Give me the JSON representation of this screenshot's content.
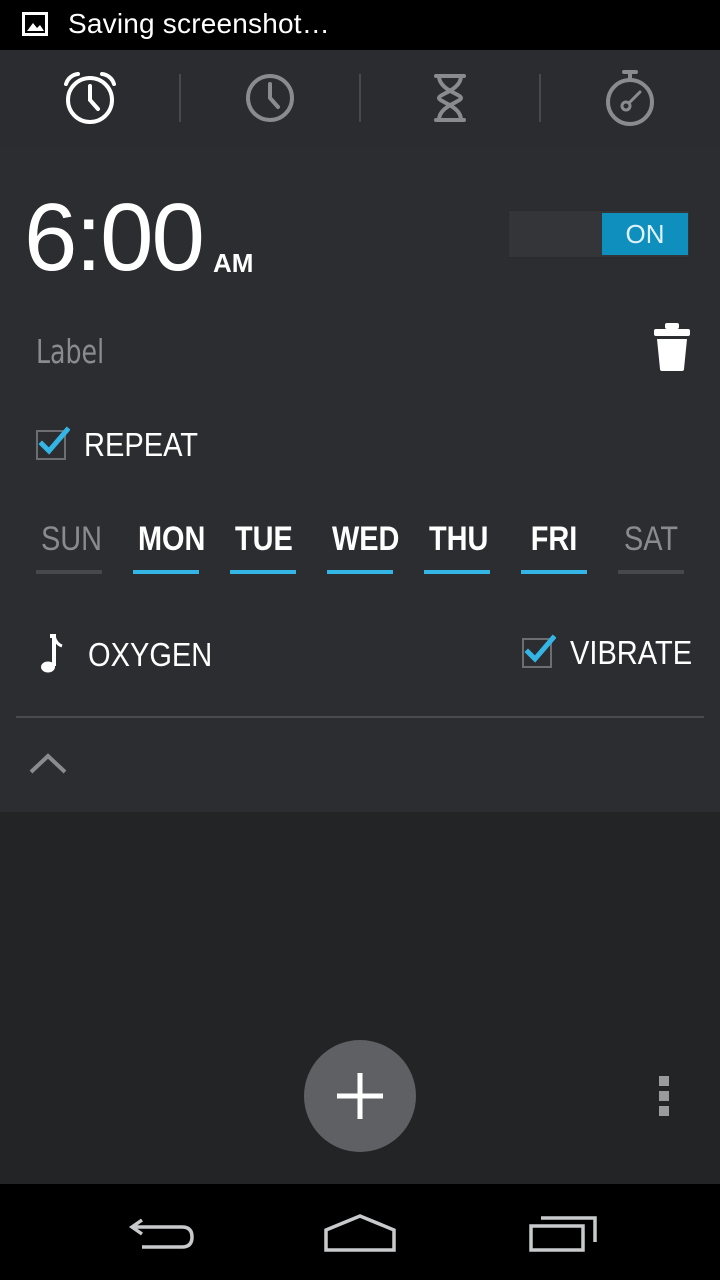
{
  "status_bar": {
    "notification_icon": "image-icon",
    "text": "Saving screenshot…"
  },
  "tabs": [
    {
      "name": "alarm",
      "icon": "alarm-clock-icon",
      "selected": true
    },
    {
      "name": "clock",
      "icon": "clock-icon",
      "selected": false
    },
    {
      "name": "timer",
      "icon": "hourglass-icon",
      "selected": false
    },
    {
      "name": "stopwatch",
      "icon": "stopwatch-icon",
      "selected": false
    }
  ],
  "alarm": {
    "time": "6:00",
    "ampm": "AM",
    "toggle_label": "ON",
    "label_placeholder": "Label",
    "repeat_label": "REPEAT",
    "repeat_checked": true,
    "days": [
      {
        "label": "SUN",
        "active": false
      },
      {
        "label": "MON",
        "active": true
      },
      {
        "label": "TUE",
        "active": true
      },
      {
        "label": "WED",
        "active": true
      },
      {
        "label": "THU",
        "active": true
      },
      {
        "label": "FRI",
        "active": true
      },
      {
        "label": "SAT",
        "active": false
      }
    ],
    "ringtone_icon": "music-note-icon",
    "ringtone": "OXYGEN",
    "vibrate_label": "VIBRATE",
    "vibrate_checked": true,
    "collapse_icon": "chevron-up-icon",
    "delete_icon": "trash-icon"
  },
  "fab_icon": "plus-icon",
  "overflow_icon": "overflow-menu-icon",
  "nav": {
    "back_icon": "back-icon",
    "home_icon": "home-icon",
    "recents_icon": "recents-icon"
  },
  "colors": {
    "accent": "#33b5e5",
    "toggle_on": "#0f8fbe",
    "inactive_day": "#8a8b8e"
  }
}
